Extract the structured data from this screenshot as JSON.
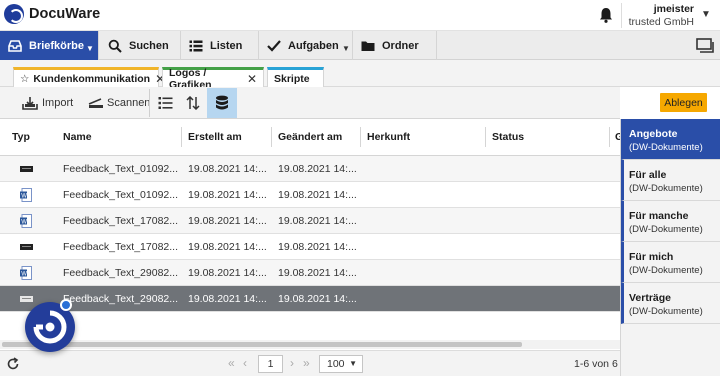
{
  "header": {
    "app_name": "DocuWare",
    "user_name": "jmeister",
    "org_name": "trusted GmbH"
  },
  "nav": {
    "briefkorbe": "Briefkörbe",
    "suchen": "Suchen",
    "listen": "Listen",
    "aufgaben": "Aufgaben",
    "ordner": "Ordner"
  },
  "tabs": [
    {
      "label": "Kundenkommunikation",
      "color": "#f0b429"
    },
    {
      "label": "Logos / Grafiken",
      "color": "#43a047"
    },
    {
      "label": "Skripte",
      "color": "#29a3d6"
    }
  ],
  "toolbar": {
    "import_label": "Import",
    "scan_label": "Scannen",
    "ablegen_label": "Ablegen"
  },
  "table": {
    "columns": [
      "Typ",
      "Name",
      "Erstellt am",
      "Geändert am",
      "Herkunft",
      "Status",
      "G"
    ],
    "rows": [
      {
        "type": "text-file",
        "name": "Feedback_Text_01092...",
        "created": "19.08.2021 14:...",
        "modified": "19.08.2021 14:..."
      },
      {
        "type": "word-file",
        "name": "Feedback_Text_01092...",
        "created": "19.08.2021 14:...",
        "modified": "19.08.2021 14:..."
      },
      {
        "type": "word-file",
        "name": "Feedback_Text_17082...",
        "created": "19.08.2021 14:...",
        "modified": "19.08.2021 14:..."
      },
      {
        "type": "text-file",
        "name": "Feedback_Text_17082...",
        "created": "19.08.2021 14:...",
        "modified": "19.08.2021 14:..."
      },
      {
        "type": "word-file",
        "name": "Feedback_Text_29082...",
        "created": "19.08.2021 14:...",
        "modified": "19.08.2021 14:..."
      },
      {
        "type": "text-file",
        "name": "Feedback_Text_29082...",
        "created": "19.08.2021 14:...",
        "modified": "19.08.2021 14:...",
        "selected": true
      }
    ]
  },
  "pagination": {
    "page": "1",
    "page_size": "100",
    "count": "1-6 von 6"
  },
  "trays": [
    {
      "title": "Angebote",
      "subtitle": "(DW-Dokumente)",
      "active": true
    },
    {
      "title": "Für alle",
      "subtitle": "(DW-Dokumente)"
    },
    {
      "title": "Für manche",
      "subtitle": "(DW-Dokumente)"
    },
    {
      "title": "Für mich",
      "subtitle": "(DW-Dokumente)"
    },
    {
      "title": "Verträge",
      "subtitle": "(DW-Dokumente)"
    }
  ],
  "colors": {
    "brand_blue": "#2a4ea8",
    "ablegen_orange": "#f6a800",
    "selected_row": "#6f7378"
  }
}
